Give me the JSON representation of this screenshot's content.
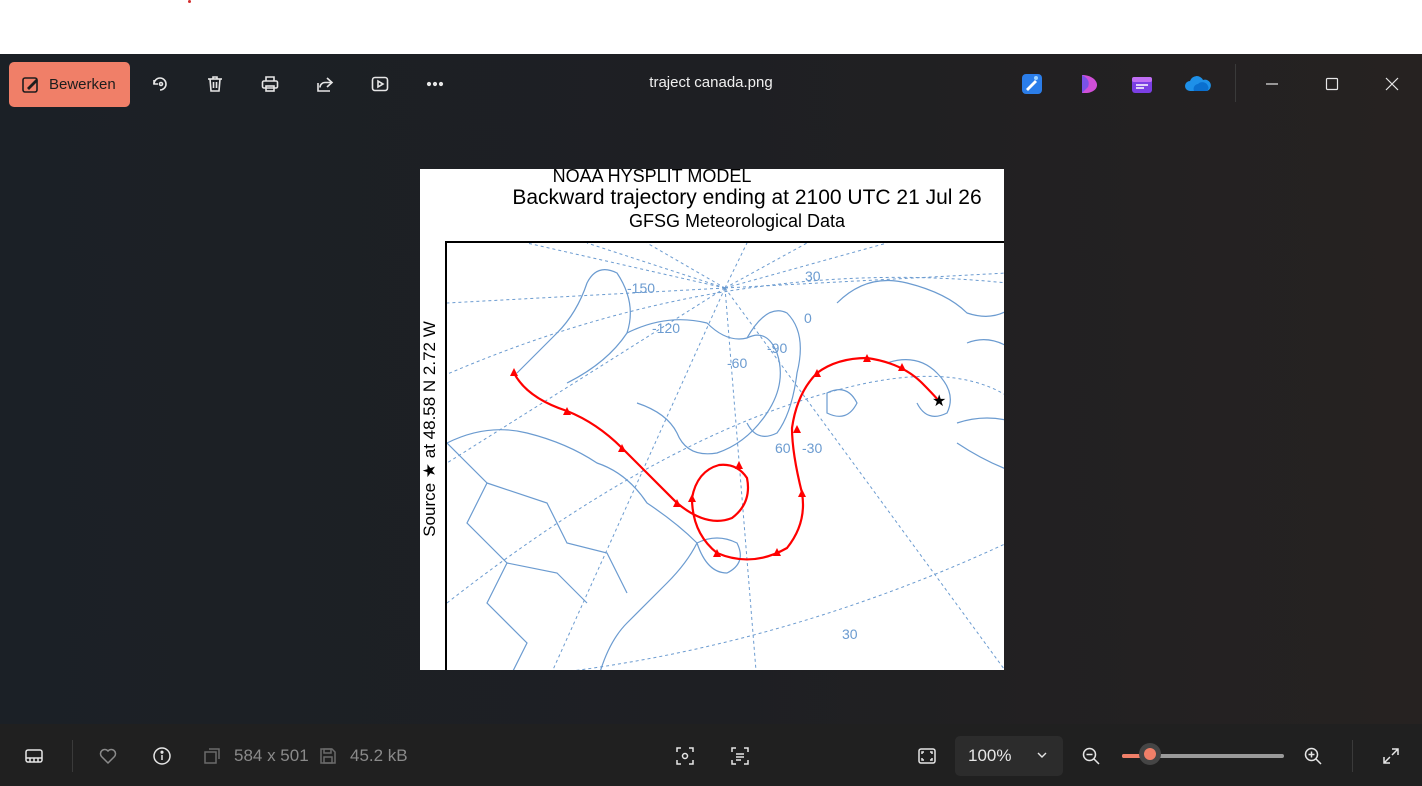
{
  "window": {
    "title": "traject canada.png"
  },
  "toolbar": {
    "edit_label": "Bewerken",
    "icons": [
      "rotate-icon",
      "delete-icon",
      "print-icon",
      "share-icon",
      "slideshow-icon",
      "more-icon"
    ],
    "apps": [
      "designer-icon",
      "clipchamp-pink-icon",
      "clipchamp-icon",
      "onedrive-icon"
    ]
  },
  "image": {
    "title_line1": "NOAA HYSPLIT MODEL",
    "title_line2": "Backward trajectory ending at 2100 UTC 21 Jul 26",
    "title_line3": "GFSG Meteorological Data",
    "side_label": "Source ★  at   48.58 N    2.72 W",
    "map_labels": {
      "lon_150": "-150",
      "lon_120": "-120",
      "lon_90": "-90",
      "lon_60": "-60",
      "lon_30": "-30",
      "lon_0": "0",
      "lat_30_top": "30",
      "lat_60": "60",
      "lat_30_bottom": "30"
    },
    "trajectory_color": "#ff0000",
    "map_line_color": "#6b9bd0"
  },
  "bottombar": {
    "dimensions": "584 x 501",
    "file_size": "45.2 kB",
    "zoom": "100%",
    "zoom_slider_fraction": 0.17
  }
}
